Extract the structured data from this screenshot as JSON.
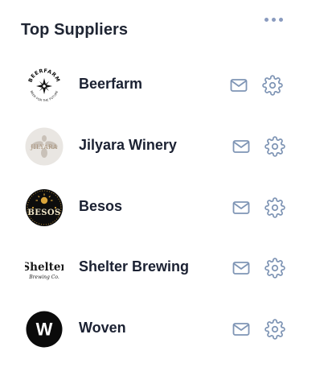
{
  "widget": {
    "title": "Top Suppliers",
    "more_icon": "more-horizontal-icon",
    "icon_color": "#7f95b5"
  },
  "suppliers": [
    {
      "name": "Beerfarm",
      "logo_text": "BEERFARM",
      "logo_subtext": "BEER FOR THE FUTURE",
      "logo_icon": "star-compass-logo"
    },
    {
      "name": "Jilyara Winery",
      "logo_text": "JILYARA",
      "logo_icon": "bee-logo"
    },
    {
      "name": "Besos",
      "logo_text": "BESOS",
      "logo_icon": "sun-badge-logo"
    },
    {
      "name": "Shelter Brewing",
      "logo_text": "Shelter",
      "logo_subtext": "Brewing Co.",
      "logo_icon": "wordmark-logo"
    },
    {
      "name": "Woven",
      "logo_text": "W",
      "logo_icon": "circle-w-logo"
    }
  ],
  "actions": {
    "mail_icon": "mail-icon",
    "settings_icon": "gear-icon"
  }
}
